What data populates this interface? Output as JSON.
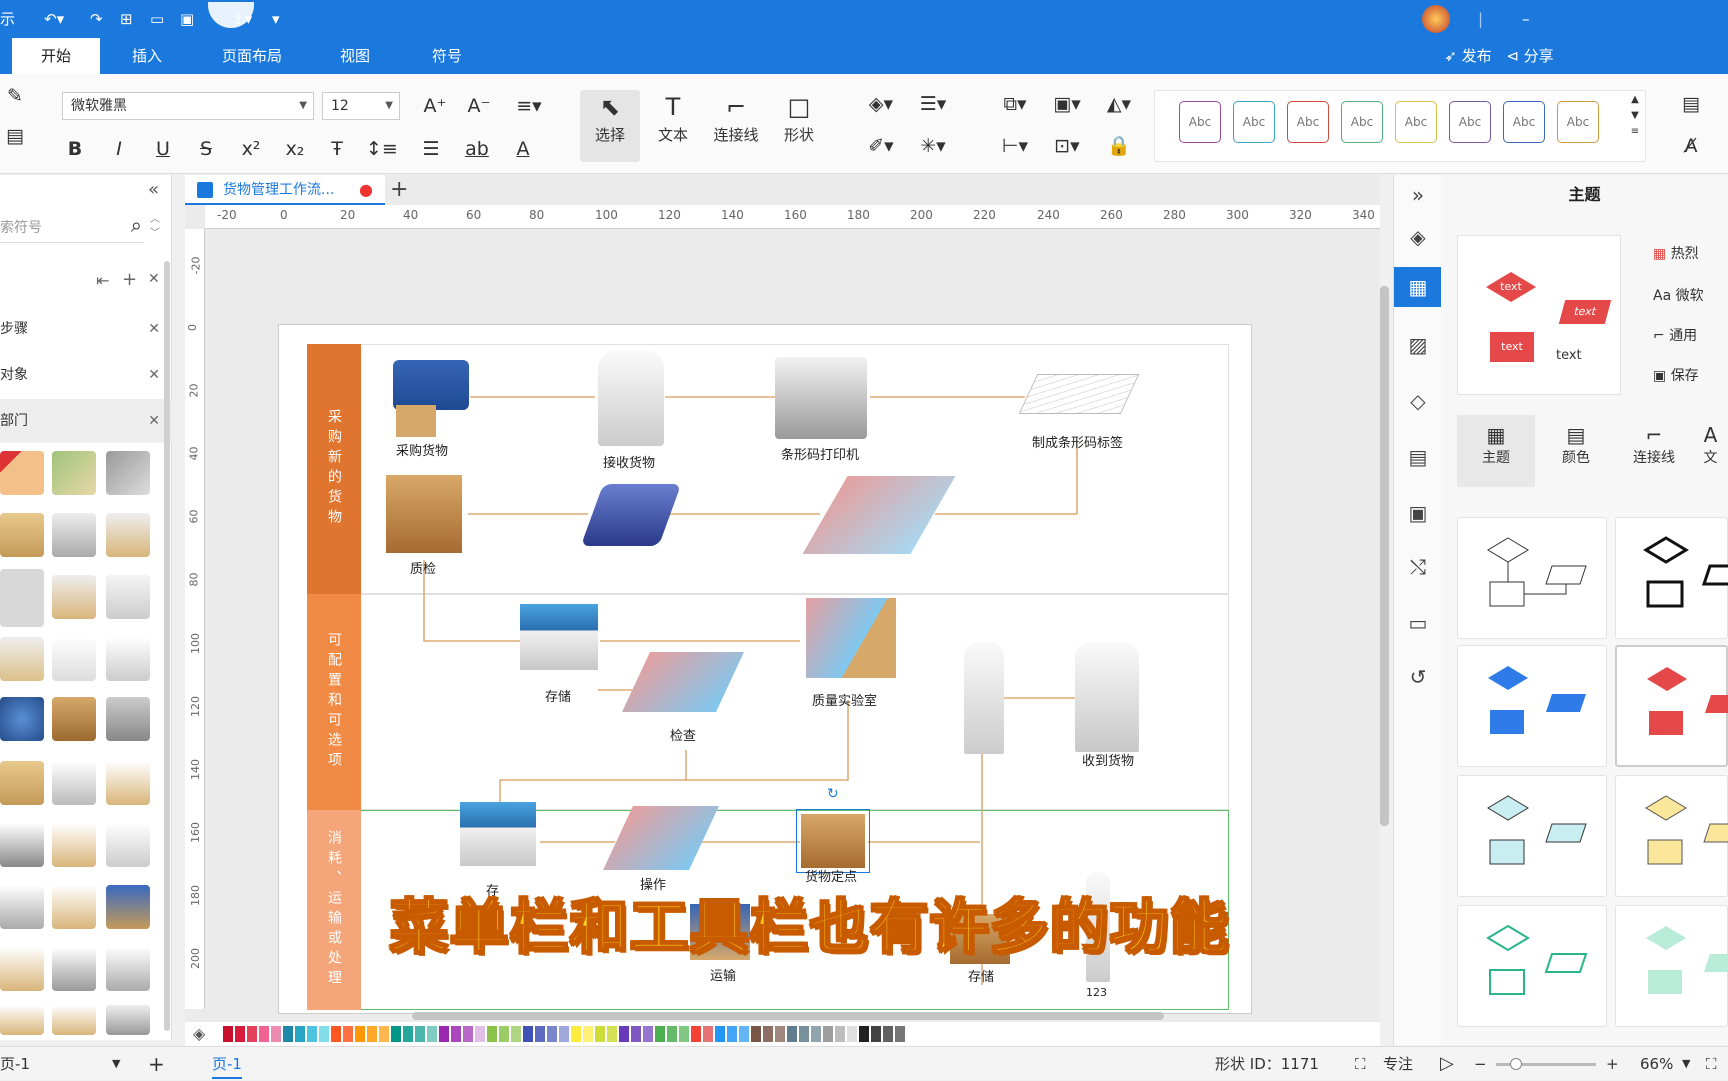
{
  "app": {
    "title_fragment": "示",
    "publish_label": "发布",
    "share_label": "分享"
  },
  "menu": {
    "tabs": [
      "开始",
      "插入",
      "页面布局",
      "视图",
      "符号"
    ],
    "active_index": 0
  },
  "toolbar": {
    "font_family": "微软雅黑",
    "font_size": "12",
    "select_label": "选择",
    "text_label": "文本",
    "connector_label": "连接线",
    "shape_label": "形状",
    "style_swatch_label": "Abc",
    "swatch_colors": [
      "#a04c9e",
      "#3aa7c2",
      "#d04a3e",
      "#4ab07a",
      "#d8c34a",
      "#7a5aa0",
      "#3a6ac0",
      "#d09a40"
    ]
  },
  "left_panel": {
    "search_placeholder": "索符号",
    "sections": [
      "步骤",
      "对象",
      "部门"
    ]
  },
  "document": {
    "tab_title": "货物管理工作流...",
    "ruler_h": [
      "-20",
      "0",
      "20",
      "40",
      "60",
      "80",
      "100",
      "120",
      "140",
      "160",
      "180",
      "200",
      "220",
      "240",
      "260",
      "280",
      "300",
      "320",
      "340"
    ],
    "ruler_v": [
      "-20",
      "0",
      "20",
      "40",
      "60",
      "80",
      "100",
      "120",
      "140",
      "160",
      "180",
      "200"
    ],
    "lanes": [
      {
        "title": "采购新的货物",
        "color": "#e07530"
      },
      {
        "title": "可配置和可选项",
        "color": "#f08a45"
      },
      {
        "title": "消耗、运输或处理",
        "color": "#f4a67a"
      }
    ],
    "nodes": {
      "purchase": "采购货物",
      "receive": "接收货物",
      "printer": "条形码打印机",
      "label": "制成条形码标签",
      "inspect": "质检",
      "store1": "存储",
      "check": "检查",
      "lab": "质量实验室",
      "received": "收到货物",
      "store2_partial": "存",
      "operate": "操作",
      "goods": "货物定点",
      "transport": "运输",
      "store3": "存储",
      "num": "123"
    }
  },
  "subtitle": "菜单栏和工具栏也有许多的功能",
  "right_panel": {
    "title": "主题",
    "options": [
      "热烈",
      "微软",
      "通用",
      "保存"
    ],
    "tabs": [
      "主题",
      "颜色",
      "连接线",
      "文"
    ],
    "preview_text": "text"
  },
  "statusbar": {
    "page_prefix": "页-1",
    "page_tab": "页-1",
    "shape_id": "形状 ID：1171",
    "focus_label": "专注",
    "zoom": "66%"
  },
  "palette": [
    "#c8102e",
    "#d81b3c",
    "#e4405a",
    "#f06292",
    "#ec8bb0",
    "#1e88a8",
    "#26a6c4",
    "#4fc3e0",
    "#80deea",
    "#ff5722",
    "#ff7043",
    "#ff9800",
    "#ffa726",
    "#ffb74d",
    "#009688",
    "#26a69a",
    "#4db6ac",
    "#80cbc4",
    "#9c27b0",
    "#ab47bc",
    "#ba68c8",
    "#e1bee7",
    "#8bc34a",
    "#9ccc65",
    "#aed581",
    "#3f51b5",
    "#5c6bc0",
    "#7986cb",
    "#9fa8da",
    "#ffeb3b",
    "#fff176",
    "#cddc39",
    "#d4e157",
    "#673ab7",
    "#7e57c2",
    "#9575cd",
    "#4caf50",
    "#66bb6a",
    "#81c784",
    "#f44336",
    "#e57373",
    "#2196f3",
    "#42a5f5",
    "#64b5f6",
    "#795548",
    "#8d6e63",
    "#a1887f",
    "#607d8b",
    "#78909c",
    "#90a4ae",
    "#9e9e9e",
    "#bdbdbd",
    "#e0e0e0",
    "#212121",
    "#424242",
    "#616161",
    "#757575",
    "#ffffff"
  ]
}
